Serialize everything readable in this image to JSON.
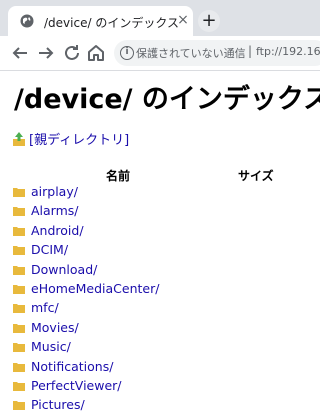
{
  "browser": {
    "tab_title": "/device/ のインデックス",
    "tab_close": "×",
    "new_tab": "+",
    "security_label": "保護されていない通信",
    "separator": "|",
    "url": "ftp://192.16"
  },
  "page": {
    "heading": "/device/ のインデックス",
    "parent_link": "[親ディレクトリ]",
    "columns": {
      "name": "名前",
      "size": "サイズ"
    },
    "entries": [
      "airplay/",
      "Alarms/",
      "Android/",
      "DCIM/",
      "Download/",
      "eHomeMediaCenter/",
      "mfc/",
      "Movies/",
      "Music/",
      "Notifications/",
      "PerfectViewer/",
      "Pictures/"
    ]
  },
  "colors": {
    "link": "#1a0dab",
    "folder": "#e8b93c",
    "tabstrip": "#dee1e6"
  }
}
